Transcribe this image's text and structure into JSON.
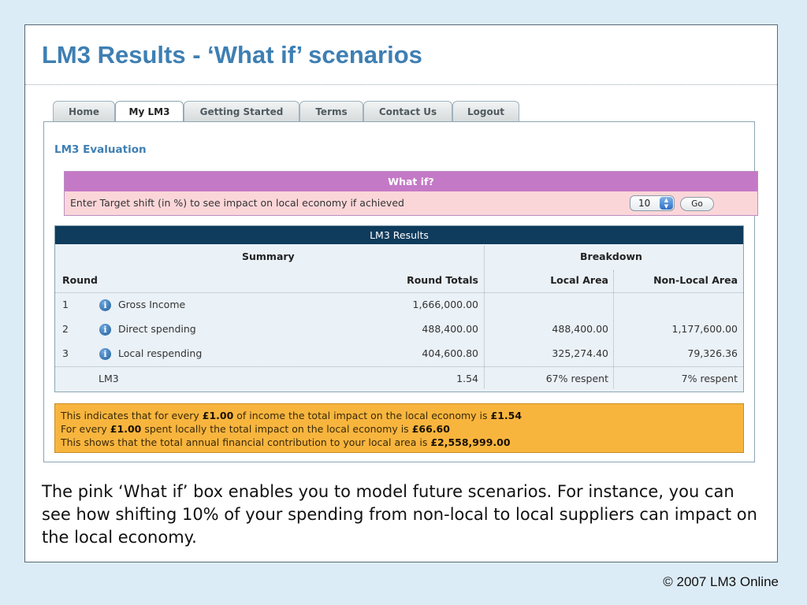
{
  "slide": {
    "title": "LM3 Results - ‘What if’ scenarios",
    "caption": "The pink ‘What if’ box enables you to model future scenarios. For instance, you can see how shifting 10% of your spending from non-local to local suppliers can impact on the local economy.",
    "copyright": "© 2007 LM3 Online"
  },
  "tabs": [
    {
      "label": "Home",
      "active": false
    },
    {
      "label": "My LM3",
      "active": true
    },
    {
      "label": "Getting Started",
      "active": false
    },
    {
      "label": "Terms",
      "active": false
    },
    {
      "label": "Contact Us",
      "active": false
    },
    {
      "label": "Logout",
      "active": false
    }
  ],
  "evaluation": {
    "heading": "LM3 Evaluation",
    "whatif": {
      "title": "What if?",
      "prompt": "Enter Target shift (in %) to see impact on local economy if achieved",
      "selected_value": "10",
      "go_label": "Go"
    }
  },
  "results": {
    "title": "LM3 Results",
    "groups": {
      "summary": "Summary",
      "breakdown": "Breakdown"
    },
    "columns": {
      "round": "Round",
      "round_totals": "Round Totals",
      "local_area": "Local Area",
      "non_local_area": "Non-Local Area"
    },
    "rows": [
      {
        "round": "1",
        "label": "Gross Income",
        "total": "1,666,000.00",
        "local": "",
        "non_local": ""
      },
      {
        "round": "2",
        "label": "Direct spending",
        "total": "488,400.00",
        "local": "488,400.00",
        "non_local": "1,177,600.00"
      },
      {
        "round": "3",
        "label": "Local respending",
        "total": "404,600.80",
        "local": "325,274.40",
        "non_local": "79,326.36"
      }
    ],
    "lm3_row": {
      "label": "LM3",
      "total": "1.54",
      "local": "67% respent",
      "non_local": "7% respent"
    }
  },
  "note": {
    "line1_a": "This indicates that for every ",
    "line1_b": "£1.00",
    "line1_c": " of income the total impact on the local economy is ",
    "line1_d": "£1.54",
    "line2_a": "For every ",
    "line2_b": "£1.00",
    "line2_c": " spent locally the total impact on the local economy is ",
    "line2_d": "£66.60",
    "line3_a": "This shows that the total annual financial contribution to your local area is ",
    "line3_b": "£2,558,999.00"
  },
  "colors": {
    "title": "#3e7fb3",
    "whatif_header": "#c479c6",
    "whatif_body": "#fbd6d9",
    "results_header": "#0f3b5c",
    "note_background": "#f8b53e"
  },
  "icons": {
    "row_info": "info-icon",
    "select_spinner": "chevron-up-down-icon"
  }
}
